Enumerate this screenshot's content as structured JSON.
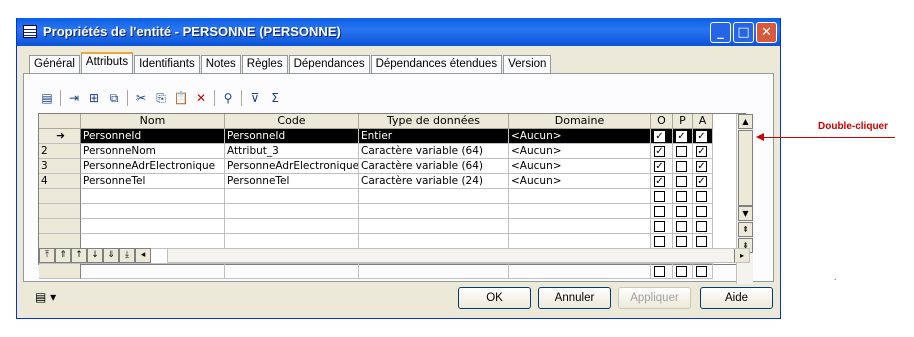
{
  "window": {
    "title": "Propriétés de l'entité - PERSONNE (PERSONNE)"
  },
  "tabs": [
    "Général",
    "Attributs",
    "Identifiants",
    "Notes",
    "Règles",
    "Dépendances",
    "Dépendances étendues",
    "Version"
  ],
  "active_tab": "Attributs",
  "grid": {
    "headers": [
      "Nom",
      "Code",
      "Type de données",
      "Domaine",
      "O",
      "P",
      "A"
    ],
    "rows": [
      {
        "num": "",
        "nom": "PersonneId",
        "code": "PersonneId",
        "type": "Entier",
        "domaine": "<Aucun>",
        "o": true,
        "p": true,
        "a": true,
        "selected": true
      },
      {
        "num": "2",
        "nom": "PersonneNom",
        "code": "Attribut_3",
        "type": "Caractère variable (64)",
        "domaine": "<Aucun>",
        "o": true,
        "p": false,
        "a": true
      },
      {
        "num": "3",
        "nom": "PersonneAdrElectronique",
        "code": "PersonneAdrElectronique",
        "type": "Caractère variable (64)",
        "domaine": "<Aucun>",
        "o": true,
        "p": false,
        "a": true
      },
      {
        "num": "4",
        "nom": "PersonneTel",
        "code": "PersonneTel",
        "type": "Caractère variable (24)",
        "domaine": "<Aucun>",
        "o": true,
        "p": false,
        "a": true
      }
    ],
    "empty_rows": 6
  },
  "buttons": {
    "ok": "OK",
    "cancel": "Annuler",
    "apply": "Appliquer",
    "help": "Aide"
  },
  "annotation": {
    "text": "Double-cliquer",
    "color": "#cc0000"
  }
}
